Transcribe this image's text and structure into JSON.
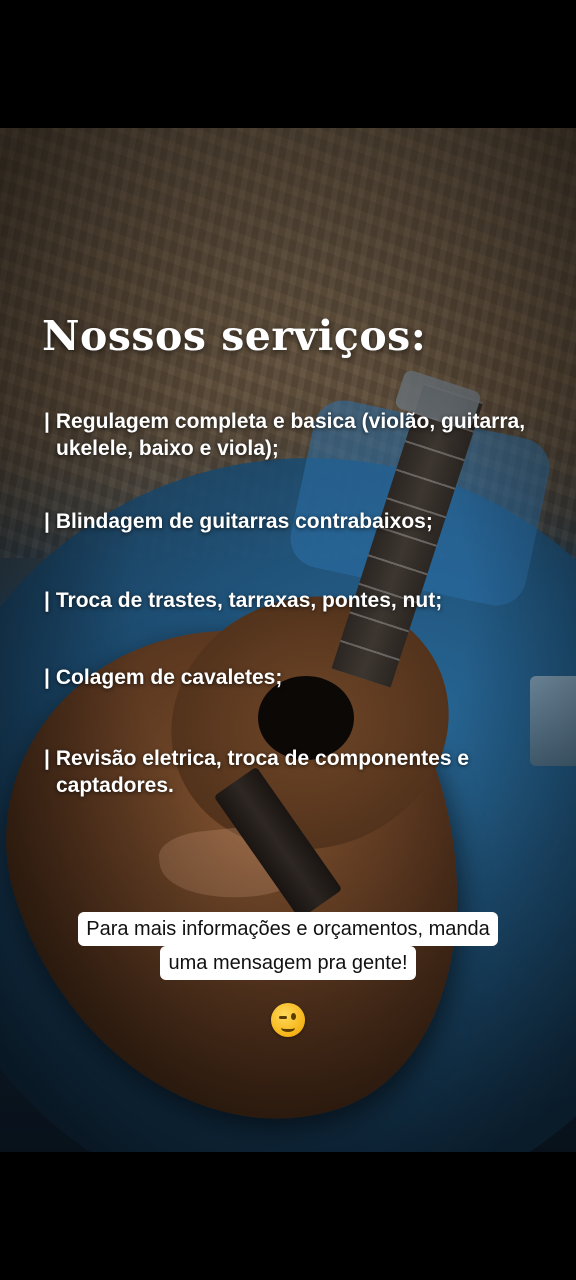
{
  "story": {
    "title": "Nossos serviços:",
    "services": [
      {
        "bar": "|",
        "line1": "Regulagem completa e basica (violão, guitarra,",
        "line2": "ukelele, baixo e viola);"
      },
      {
        "bar": "|",
        "line1": "Blindagem de guitarras contrabaixos;"
      },
      {
        "bar": "|",
        "line1": "Troca de trastes, tarraxas, pontes, nut;"
      },
      {
        "bar": "|",
        "line1": "Colagem de cavaletes;"
      },
      {
        "bar": "|",
        "line1": "Revisão eletrica, troca de componentes e",
        "line2": "captadores."
      }
    ],
    "caption": {
      "line1": "Para mais informações e orçamentos, manda",
      "line2": "uma mensagem pra gente!"
    },
    "emoji_icon": "winking-face-icon"
  },
  "colors": {
    "text": "#ffffff",
    "caption_bg": "#ffffff",
    "caption_text": "#111111"
  }
}
